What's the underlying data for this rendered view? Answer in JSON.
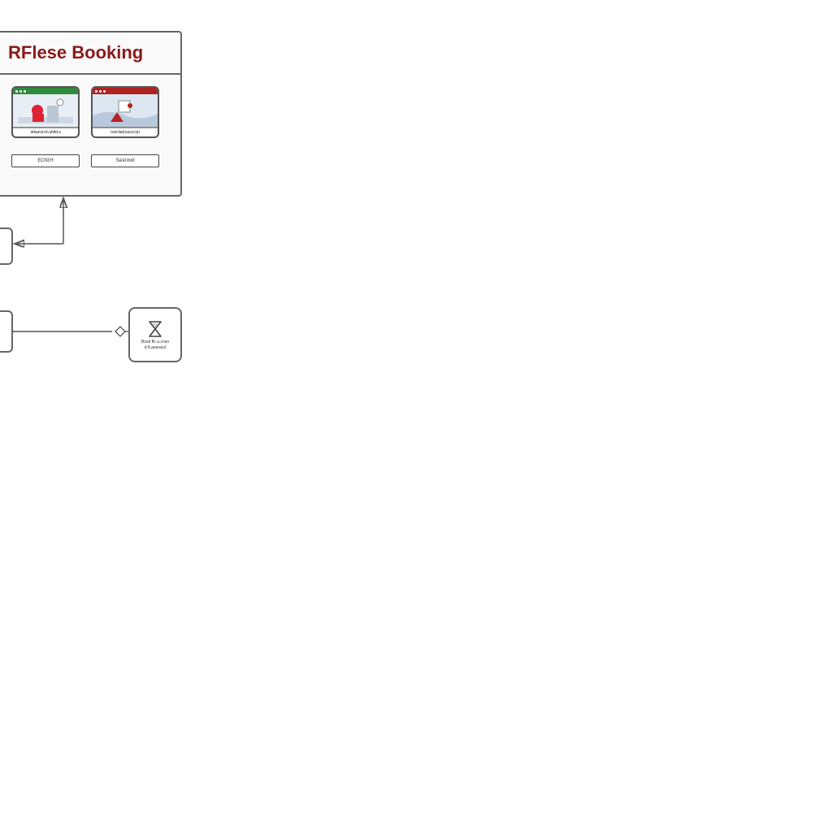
{
  "title": "RFlese Booking",
  "cards": {
    "a": {
      "label": "ddsurcd.nn.ahAd.a"
    },
    "b": {
      "label": "rssd tadccacco.ta.l"
    }
  },
  "buttons": {
    "a": "ECNI:H",
    "b": "Sa'el  inrd"
  },
  "node": {
    "line1": "Bosd ffc a.cnso",
    "line2": "d.fLaearacd"
  }
}
